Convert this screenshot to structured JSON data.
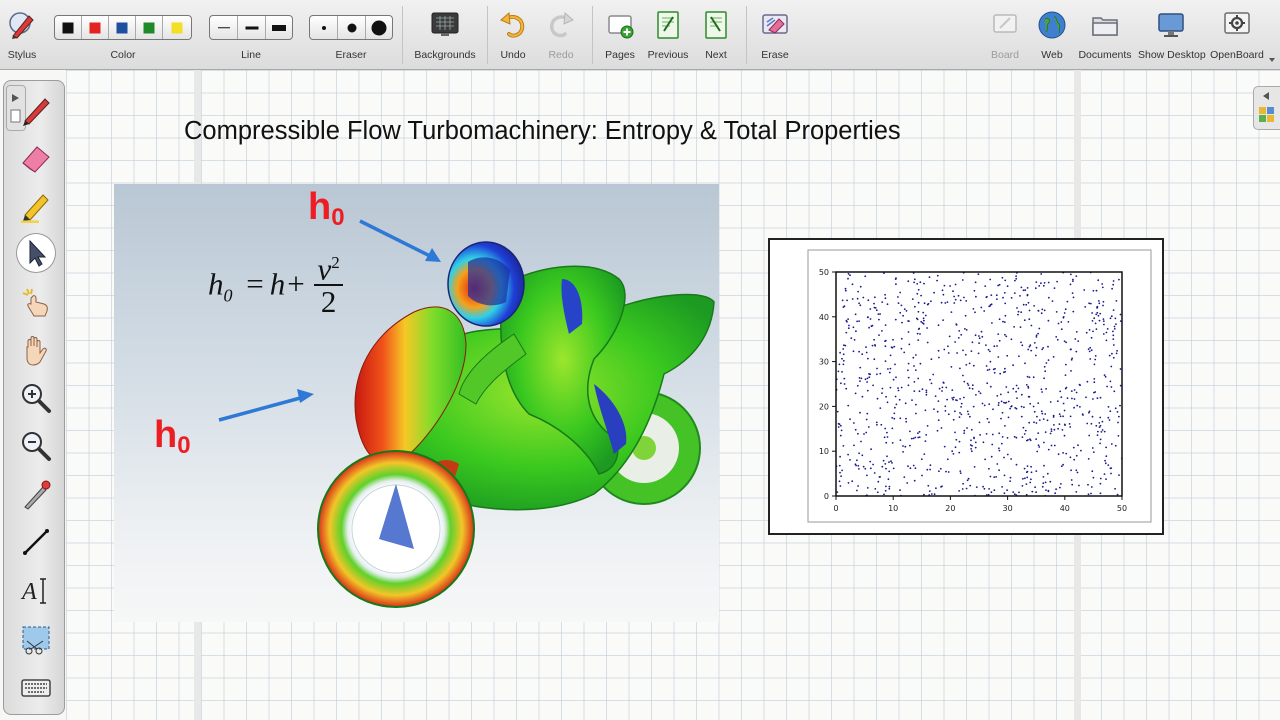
{
  "toolbar": {
    "stylus": "Stylus",
    "color": "Color",
    "line": "Line",
    "eraser": "Eraser",
    "backgrounds": "Backgrounds",
    "undo": "Undo",
    "redo": "Redo",
    "pages": "Pages",
    "previous": "Previous",
    "next": "Next",
    "erase": "Erase",
    "board": "Board",
    "web": "Web",
    "documents": "Documents",
    "show_desktop": "Show Desktop",
    "openboard": "OpenBoard",
    "colors": [
      "#111111",
      "#e52222",
      "#1c4f9c",
      "#1f8a2a",
      "#f3df23"
    ]
  },
  "slide": {
    "title": "Compressible Flow Turbomachinery: Entropy & Total Properties",
    "image": {
      "label_h": "h",
      "label_sub": "0",
      "formula_lhs": "h",
      "formula_lhs_sub": "0",
      "formula_eq": "=",
      "formula_h": "h",
      "formula_plus": "+",
      "formula_num": "v",
      "formula_exp": "2",
      "formula_den": "2"
    }
  },
  "chart_data": {
    "type": "scatter",
    "title": "",
    "xlabel": "",
    "ylabel": "",
    "xlim": [
      0,
      50
    ],
    "ylim": [
      0,
      50
    ],
    "xticks": [
      0,
      10,
      20,
      30,
      40,
      50
    ],
    "yticks": [
      0,
      10,
      20,
      30,
      40,
      50
    ],
    "point_color": "#1a1a8c",
    "n_points": 1000,
    "distribution": "uniform random over [0,50] x [0,50]",
    "sample_points": [
      [
        2.1,
        48.5
      ],
      [
        7.4,
        3.2
      ],
      [
        15.8,
        22.6
      ],
      [
        24.3,
        41.0
      ],
      [
        33.9,
        12.7
      ],
      [
        41.2,
        30.4
      ],
      [
        47.6,
        6.9
      ],
      [
        11.5,
        35.1
      ],
      [
        28.7,
        27.3
      ],
      [
        45.0,
        45.8
      ]
    ]
  }
}
